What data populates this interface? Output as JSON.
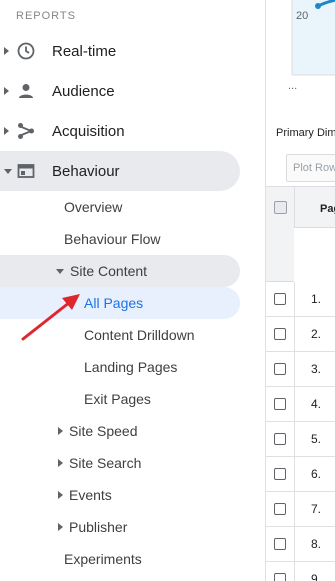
{
  "sidebar": {
    "section_title": "REPORTS",
    "top_items": [
      {
        "label": "Real-time",
        "icon": "clock-icon"
      },
      {
        "label": "Audience",
        "icon": "person-icon"
      },
      {
        "label": "Acquisition",
        "icon": "acquisition-icon"
      },
      {
        "label": "Behaviour",
        "icon": "behaviour-icon",
        "expanded": true
      }
    ],
    "behaviour_children": [
      {
        "label": "Overview"
      },
      {
        "label": "Behaviour Flow"
      },
      {
        "label": "Site Content",
        "expanded": true
      },
      {
        "label": "All Pages",
        "selected": true
      },
      {
        "label": "Content Drilldown"
      },
      {
        "label": "Landing Pages"
      },
      {
        "label": "Exit Pages"
      },
      {
        "label": "Site Speed"
      },
      {
        "label": "Site Search"
      },
      {
        "label": "Events"
      },
      {
        "label": "Publisher"
      },
      {
        "label": "Experiments"
      }
    ]
  },
  "report": {
    "chart_tick": "20",
    "chart_ellipsis": "...",
    "primary_dimension_label": "Primary Dim",
    "plot_rows_button": "Plot Row",
    "table_header": "Pag",
    "row_numbers": [
      "1.",
      "2.",
      "3.",
      "4.",
      "5.",
      "6.",
      "7.",
      "8.",
      "9."
    ]
  },
  "colors": {
    "selected_text": "#1a73e8",
    "selected_bg": "#e8f0fe",
    "expanded_bg": "#e8eaed",
    "annotation_arrow": "#e0262d",
    "chart_line": "#1e88c7"
  }
}
